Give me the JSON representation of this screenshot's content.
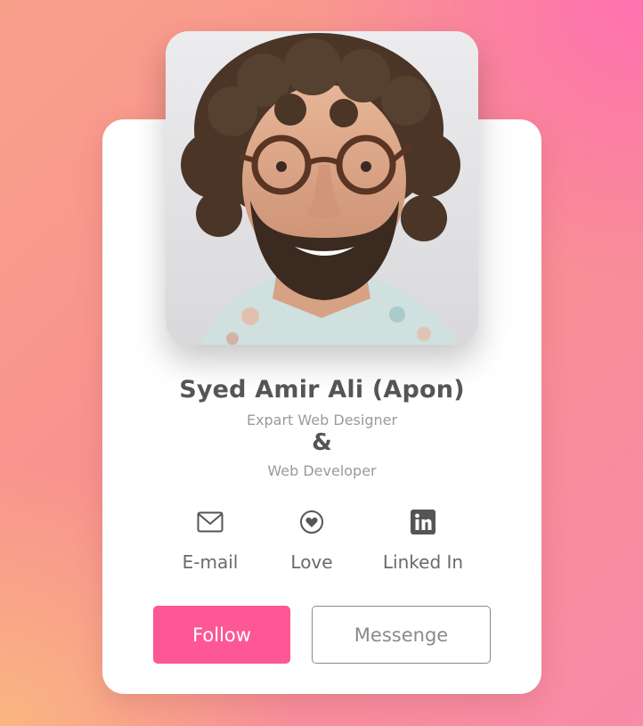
{
  "profile": {
    "name": "Syed Amir Ali (Apon)",
    "role_primary": "Expart Web Designer",
    "ampersand": "&",
    "role_secondary": "Web Developer"
  },
  "social": [
    {
      "label": "E-mail",
      "icon": "envelope-icon"
    },
    {
      "label": "Love",
      "icon": "heart-icon"
    },
    {
      "label": "Linked In",
      "icon": "linkedin-icon"
    }
  ],
  "buttons": {
    "follow_label": "Follow",
    "message_label": "Messenge"
  },
  "colors": {
    "accent": "#fd5795",
    "text_dark": "#555555",
    "text_muted": "#9a9a9a",
    "card": "#ffffff"
  }
}
